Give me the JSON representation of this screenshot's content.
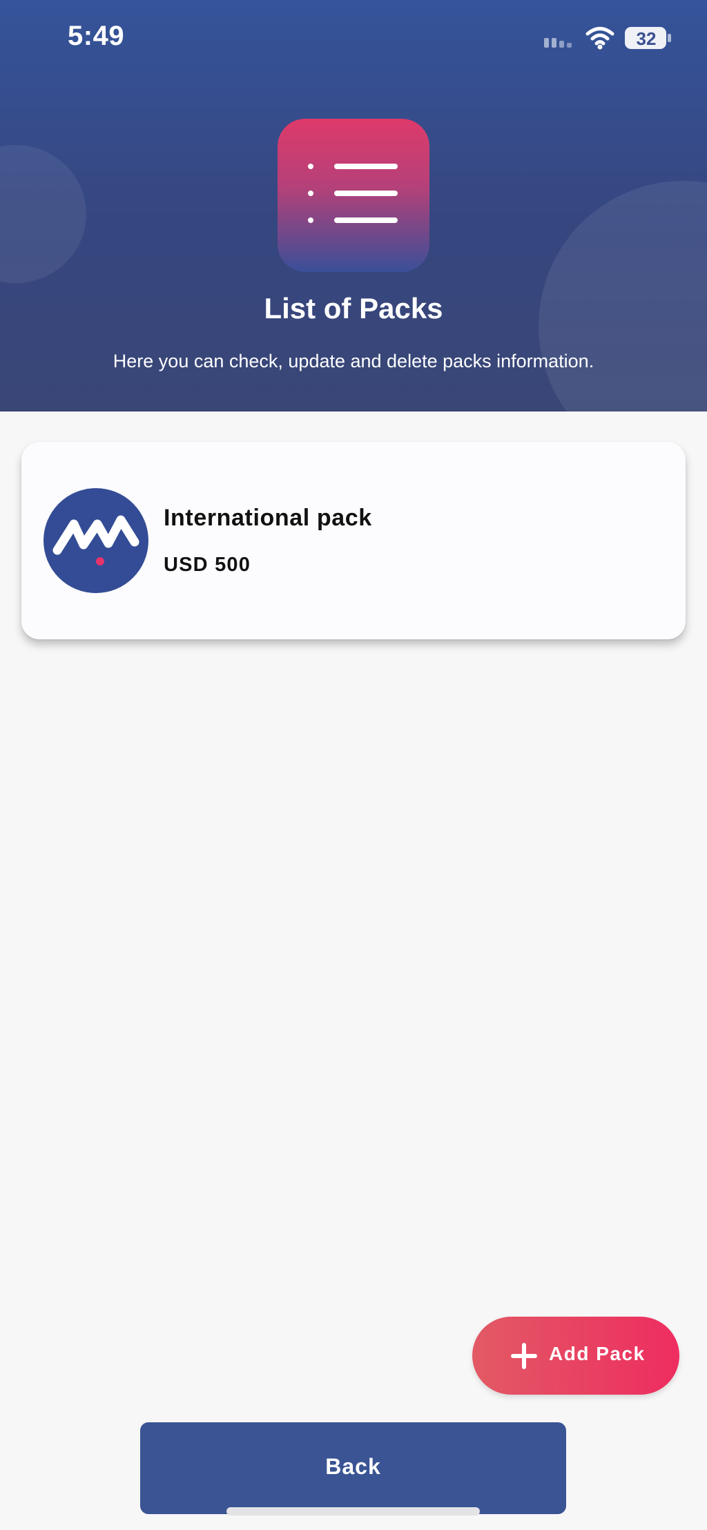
{
  "status_bar": {
    "time": "5:49",
    "battery_level": "32",
    "signal_icon": "cellular-signal-icon",
    "wifi_icon": "wifi-icon",
    "battery_icon": "battery-icon"
  },
  "header": {
    "icon": "list-icon",
    "title": "List of Packs",
    "subtitle": "Here you can check, update and delete packs information."
  },
  "packs": [
    {
      "name": "International pack",
      "price": "USD 500",
      "logo": "brand-logo-icon"
    }
  ],
  "fab": {
    "label": "Add Pack",
    "icon": "plus-icon"
  },
  "footer": {
    "back_label": "Back"
  },
  "colors": {
    "header_blue": "#35549a",
    "primary_blue": "#3a5494",
    "accent_pink": "#ee2d60",
    "background": "#f7f7f7",
    "card": "#fcfbfd"
  }
}
